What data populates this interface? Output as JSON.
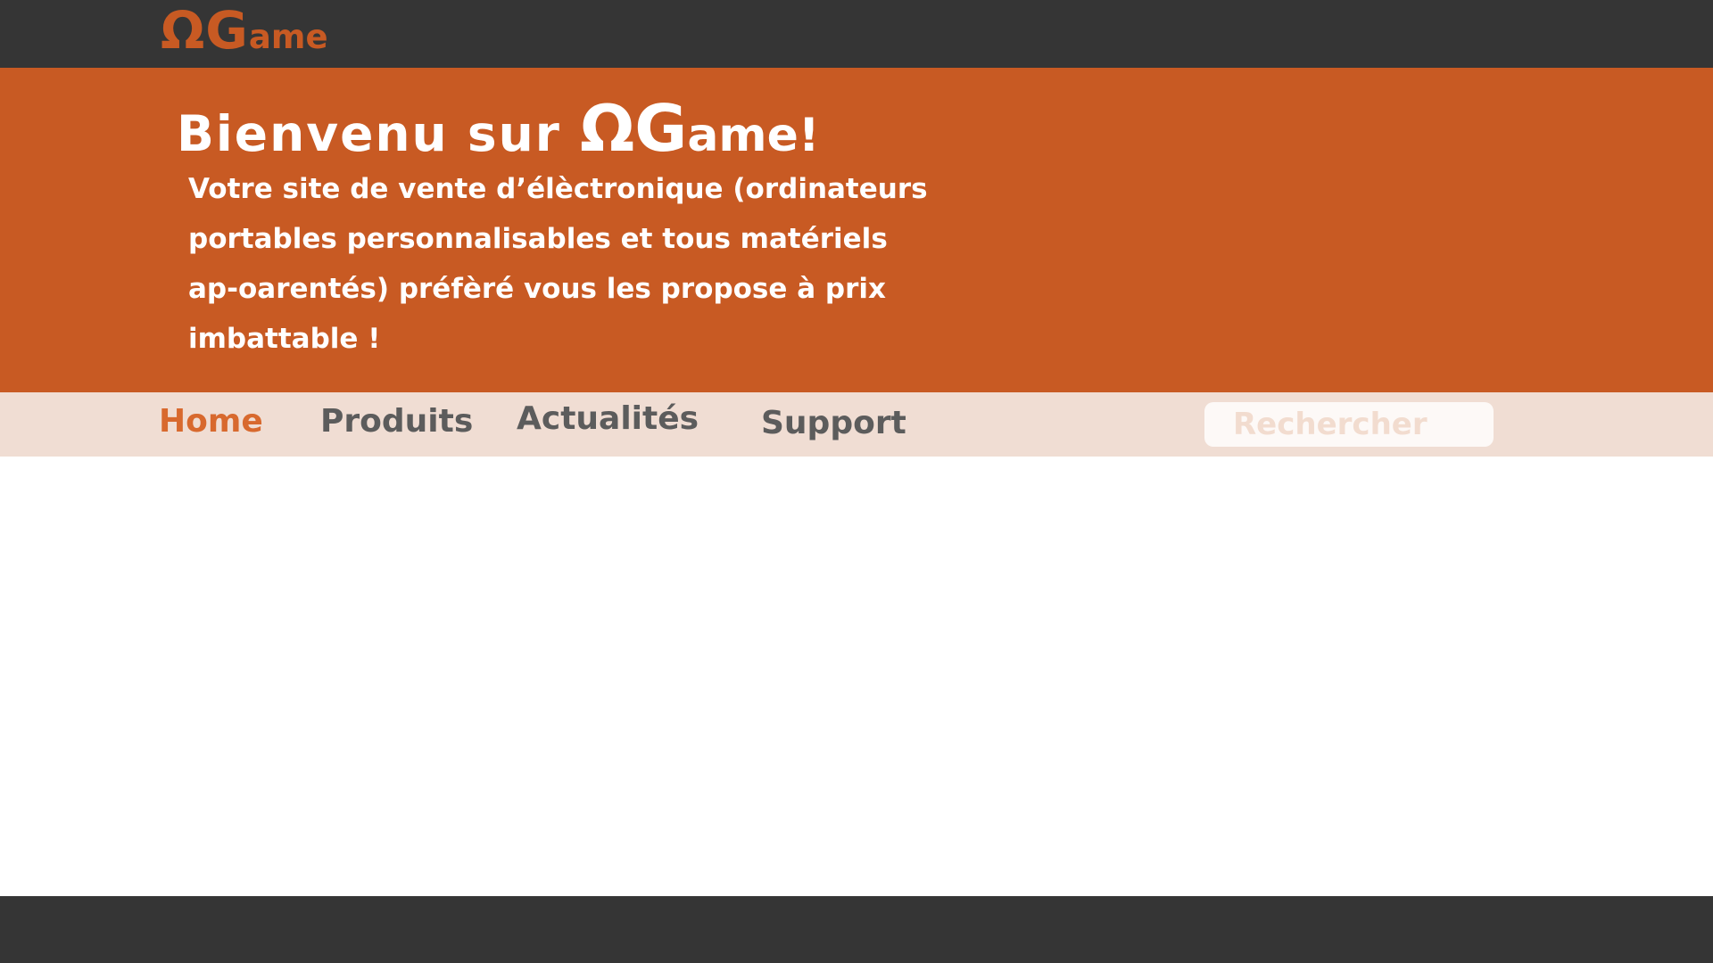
{
  "brand": {
    "logo_big": "ΩG",
    "logo_small": "ame",
    "primary_color": "#c85a23",
    "dark_color": "#353535"
  },
  "hero": {
    "title_prefix": "Bienvenu sur ",
    "title_big": "ΩG",
    "title_small": "ame!",
    "text": "Votre site de vente d’élèctronique (ordinateurs portables personnalisables et tous matériels ap-oarentés) préfèré vous les propose à prix imbattable !"
  },
  "nav": {
    "items": [
      {
        "label": "Home",
        "active": true
      },
      {
        "label": "Produits",
        "active": false
      },
      {
        "label": "Actualités",
        "active": false
      },
      {
        "label": "Support",
        "active": false
      }
    ],
    "search_placeholder": "Rechercher"
  }
}
